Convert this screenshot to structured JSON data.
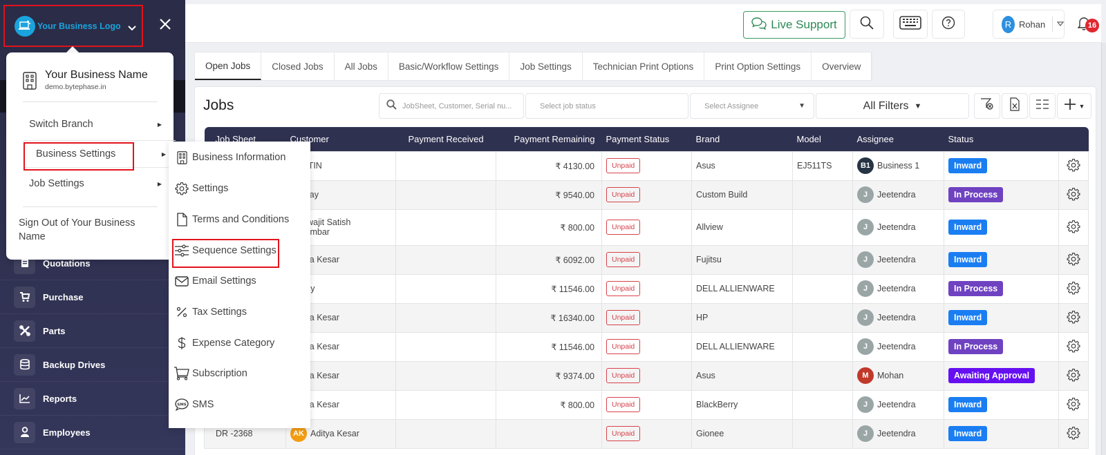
{
  "sidebar": {
    "logo_text": "Your Business Logo",
    "items": [
      {
        "label": "Quotations",
        "icon": "quotation-icon"
      },
      {
        "label": "Purchase",
        "icon": "cart-icon"
      },
      {
        "label": "Parts",
        "icon": "tools-icon"
      },
      {
        "label": "Backup Drives",
        "icon": "database-icon"
      },
      {
        "label": "Reports",
        "icon": "chart-line-icon"
      },
      {
        "label": "Employees",
        "icon": "employee-icon"
      }
    ]
  },
  "business_menu": {
    "business_name": "Your Business Name",
    "business_url": "demo.bytephase.in",
    "items": [
      {
        "label": "Switch Branch"
      },
      {
        "label": "Business Settings"
      },
      {
        "label": "Job Settings"
      }
    ],
    "sign_out": "Sign Out of Your Business Name",
    "submenu": [
      {
        "label": "Business Information",
        "icon": "building-icon"
      },
      {
        "label": "Settings",
        "icon": "gear-icon"
      },
      {
        "label": "Terms and Conditions",
        "icon": "document-icon"
      },
      {
        "label": "Sequence Settings",
        "icon": "sliders-icon"
      },
      {
        "label": "Email Settings",
        "icon": "envelope-icon"
      },
      {
        "label": "Tax Settings",
        "icon": "percent-icon"
      },
      {
        "label": "Expense Category",
        "icon": "dollar-icon"
      },
      {
        "label": "Subscription",
        "icon": "cart-icon"
      },
      {
        "label": "SMS",
        "icon": "sms-icon"
      }
    ]
  },
  "header": {
    "live_support": "Live Support",
    "user_initial": "R",
    "user_name": "Rohan",
    "notification_count": "16"
  },
  "tabs": [
    {
      "label": "Open Jobs",
      "active": true
    },
    {
      "label": "Closed Jobs"
    },
    {
      "label": "All Jobs"
    },
    {
      "label": "Basic/Workflow Settings"
    },
    {
      "label": "Job Settings"
    },
    {
      "label": "Technician Print Options"
    },
    {
      "label": "Print Option Settings"
    },
    {
      "label": "Overview"
    }
  ],
  "jobs": {
    "title": "Jobs",
    "search_placeholder": "JobSheet, Customer, Serial nu...",
    "job_status_placeholder": "Select job status",
    "assignee_placeholder": "Select Assignee",
    "all_filters": "All Filters",
    "columns": [
      "Job Sheet",
      "Customer",
      "Payment Received",
      "Payment Remaining",
      "Payment Status",
      "Brand",
      "Model",
      "Assignee",
      "Status"
    ],
    "rows": [
      {
        "job_sheet": "",
        "customer": "AUSTIN",
        "received": "",
        "remaining": "₹ 4130.00",
        "payment_status": "Unpaid",
        "brand": "Asus",
        "model": "EJ511TS",
        "assignee_initial": "B1",
        "assignee": "Business 1",
        "assignee_color": "#263445",
        "status": "Inward",
        "status_color": "#1a7ef2"
      },
      {
        "job_sheet": "",
        "customer": "Akshay",
        "received": "",
        "remaining": "₹ 9540.00",
        "payment_status": "Unpaid",
        "brand": "Custom Build",
        "model": "",
        "assignee_initial": "J",
        "assignee": "Jeetendra",
        "assignee_color": "#9aa5a6",
        "status": "In Process",
        "status_color": "#6f42c1"
      },
      {
        "job_sheet": "",
        "customer": "Vishwajit Satish Sayambar",
        "received": "",
        "remaining": "₹ 800.00",
        "payment_status": "Unpaid",
        "brand": "Allview",
        "model": "",
        "assignee_initial": "J",
        "assignee": "Jeetendra",
        "assignee_color": "#9aa5a6",
        "status": "Inward",
        "status_color": "#1a7ef2"
      },
      {
        "job_sheet": "",
        "customer": "Aditya Kesar",
        "received": "",
        "remaining": "₹ 6092.00",
        "payment_status": "Unpaid",
        "brand": "Fujitsu",
        "model": "",
        "assignee_initial": "J",
        "assignee": "Jeetendra",
        "assignee_color": "#9aa5a6",
        "status": "Inward",
        "status_color": "#1a7ef2"
      },
      {
        "job_sheet": "",
        "customer": "Abhay",
        "received": "",
        "remaining": "₹ 11546.00",
        "payment_status": "Unpaid",
        "brand": "DELL ALLIENWARE",
        "model": "",
        "assignee_initial": "J",
        "assignee": "Jeetendra",
        "assignee_color": "#9aa5a6",
        "status": "In Process",
        "status_color": "#6f42c1"
      },
      {
        "job_sheet": "",
        "customer": "Aditya Kesar",
        "received": "",
        "remaining": "₹ 16340.00",
        "payment_status": "Unpaid",
        "brand": "HP",
        "model": "",
        "assignee_initial": "J",
        "assignee": "Jeetendra",
        "assignee_color": "#9aa5a6",
        "status": "Inward",
        "status_color": "#1a7ef2"
      },
      {
        "job_sheet": "",
        "customer": "Aditya Kesar",
        "received": "",
        "remaining": "₹ 11546.00",
        "payment_status": "Unpaid",
        "brand": "DELL ALLIENWARE",
        "model": "",
        "assignee_initial": "J",
        "assignee": "Jeetendra",
        "assignee_color": "#9aa5a6",
        "status": "In Process",
        "status_color": "#6f42c1"
      },
      {
        "job_sheet": "",
        "customer": "Aditya Kesar",
        "received": "",
        "remaining": "₹ 9374.00",
        "payment_status": "Unpaid",
        "brand": "Asus",
        "model": "",
        "assignee_initial": "M",
        "assignee": "Mohan",
        "assignee_color": "#c0392b",
        "status": "Awaiting Approval",
        "status_color": "#6610f2"
      },
      {
        "job_sheet": "",
        "customer": "Aditya Kesar",
        "received": "",
        "remaining": "₹ 800.00",
        "payment_status": "Unpaid",
        "brand": "BlackBerry",
        "model": "",
        "assignee_initial": "J",
        "assignee": "Jeetendra",
        "assignee_color": "#9aa5a6",
        "status": "Inward",
        "status_color": "#1a7ef2"
      },
      {
        "job_sheet": "DR -2368",
        "customer": "Aditya Kesar",
        "customer_initial": "AK",
        "customer_color": "#f39c12",
        "received": "",
        "remaining": "",
        "payment_status": "Unpaid",
        "brand": "Gionee",
        "model": "",
        "assignee_initial": "J",
        "assignee": "Jeetendra",
        "assignee_color": "#9aa5a6",
        "status": "Inward",
        "status_color": "#1a7ef2"
      }
    ]
  }
}
